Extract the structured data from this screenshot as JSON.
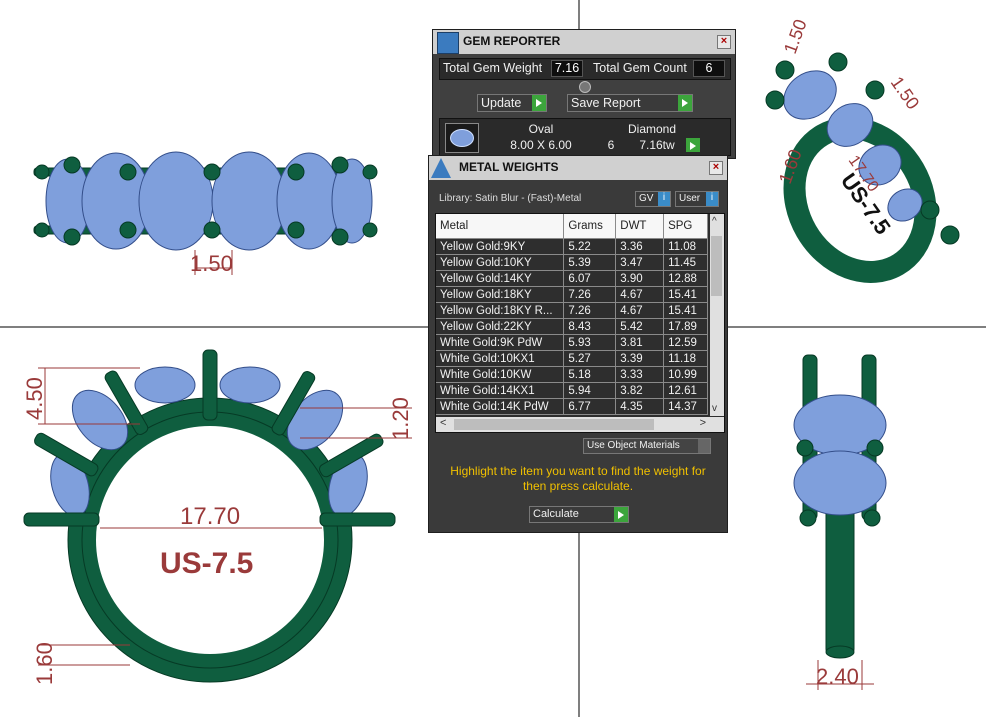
{
  "dimensions": {
    "top_left_width": "1.50",
    "side_top_1": "1.50",
    "side_top_2": "1.50",
    "side_mid_1": "17.70",
    "side_low": "1.60",
    "side_size": "US-7.5",
    "front_height": "4.50",
    "front_band": "1.20",
    "front_diameter": "17.70",
    "front_size": "US-7.5",
    "front_bottom": "1.60",
    "right_width": "2.40"
  },
  "gem_reporter": {
    "title": "GEM REPORTER",
    "close": "×",
    "total_weight_label": "Total Gem Weight",
    "total_weight_value": "7.16",
    "total_count_label": "Total Gem Count",
    "total_count_value": "6",
    "update_label": "Update",
    "save_label": "Save Report",
    "gem": {
      "shape": "Oval",
      "type": "Diamond",
      "size": "8.00 X 6.00",
      "count": "6",
      "weight": "7.16tw"
    }
  },
  "metal_weights": {
    "title": "METAL WEIGHTS",
    "close": "×",
    "library": "Library: Satin Blur - (Fast)-Metal",
    "gv_label": "GV",
    "user_label": "User",
    "columns": [
      "Metal",
      "Grams",
      "DWT",
      "SPG"
    ],
    "rows": [
      [
        "Yellow Gold:9KY",
        "5.22",
        "3.36",
        "11.08"
      ],
      [
        "Yellow Gold:10KY",
        "5.39",
        "3.47",
        "11.45"
      ],
      [
        "Yellow Gold:14KY",
        "6.07",
        "3.90",
        "12.88"
      ],
      [
        "Yellow Gold:18KY",
        "7.26",
        "4.67",
        "15.41"
      ],
      [
        "Yellow Gold:18KY R...",
        "7.26",
        "4.67",
        "15.41"
      ],
      [
        "Yellow Gold:22KY",
        "8.43",
        "5.42",
        "17.89"
      ],
      [
        "White Gold:9K PdW",
        "5.93",
        "3.81",
        "12.59"
      ],
      [
        "White Gold:10KX1",
        "5.27",
        "3.39",
        "11.18"
      ],
      [
        "White Gold:10KW",
        "5.18",
        "3.33",
        "10.99"
      ],
      [
        "White Gold:14KX1",
        "5.94",
        "3.82",
        "12.61"
      ],
      [
        "White Gold:14K PdW",
        "6.77",
        "4.35",
        "14.37"
      ]
    ],
    "use_object_materials": "Use Object Materials",
    "instruction": "Highlight the item you want to find the weight for then press calculate.",
    "calculate_label": "Calculate"
  },
  "colors": {
    "metal": "#0f5e3f",
    "gem": "#7f9fdc",
    "dimension": "#9a3a3a",
    "panel_bg": "#404040",
    "instruction_text": "#f0c000"
  }
}
